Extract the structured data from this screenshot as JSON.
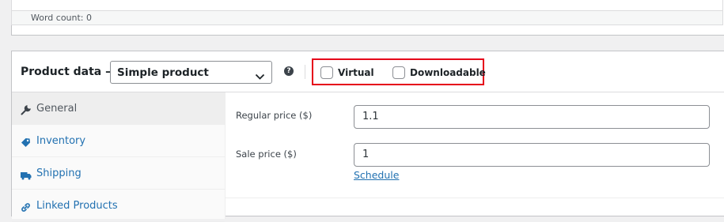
{
  "editor": {
    "word_count": "Word count: 0"
  },
  "product_data": {
    "title": "Product data —",
    "type_select": {
      "value": "Simple product"
    },
    "help": "?",
    "options": {
      "virtual": {
        "label": "Virtual",
        "checked": false
      },
      "downloadable": {
        "label": "Downloadable",
        "checked": false
      }
    },
    "tabs": [
      {
        "label": "General",
        "icon": "wrench-icon",
        "active": true
      },
      {
        "label": "Inventory",
        "icon": "tag-icon",
        "active": false
      },
      {
        "label": "Shipping",
        "icon": "truck-icon",
        "active": false
      },
      {
        "label": "Linked Products",
        "icon": "link-icon",
        "active": false
      }
    ],
    "general": {
      "regular_price_label": "Regular price ($)",
      "regular_price_value": "1.1",
      "sale_price_label": "Sale price ($)",
      "sale_price_value": "1",
      "schedule_link": "Schedule"
    }
  },
  "colors": {
    "link": "#2271b1",
    "highlight_border": "#e5001a",
    "page_background": "#f0f0f1"
  }
}
